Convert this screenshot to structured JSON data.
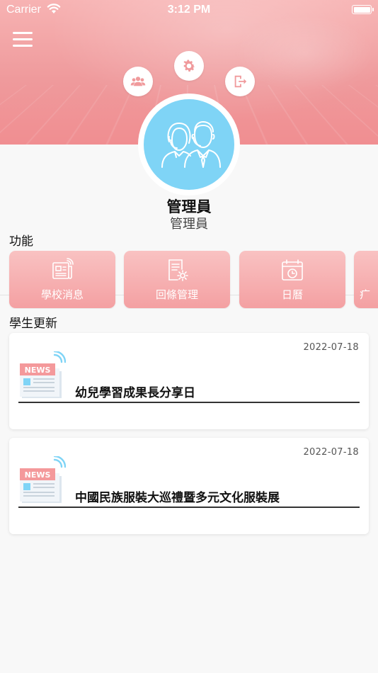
{
  "status_bar": {
    "carrier": "Carrier",
    "time": "3:12 PM"
  },
  "header": {
    "icons": [
      "menu-icon",
      "group-icon",
      "gear-icon",
      "logout-icon"
    ]
  },
  "profile": {
    "name": "管理員",
    "role": "管理員",
    "avatar_icon": "support-staff-icon"
  },
  "functions": {
    "label": "功能",
    "items": [
      {
        "label": "學校消息",
        "icon": "news-icon"
      },
      {
        "label": "回條管理",
        "icon": "document-gear-icon"
      },
      {
        "label": "日曆",
        "icon": "calendar-icon"
      },
      {
        "label": "疒",
        "icon": "app-icon"
      }
    ]
  },
  "updates": {
    "label": "學生更新",
    "items": [
      {
        "date": "2022-07-18",
        "title": "幼兒學習成果長分享日",
        "badge": "NEWS"
      },
      {
        "date": "2022-07-18",
        "title": "中國民族服裝大巡禮暨多元文化服裝展",
        "badge": "NEWS"
      }
    ]
  },
  "colors": {
    "accent_pink": "#f4a0a2",
    "avatar_blue": "#7fd4f6",
    "hero_pink": "#ef9a9c"
  }
}
